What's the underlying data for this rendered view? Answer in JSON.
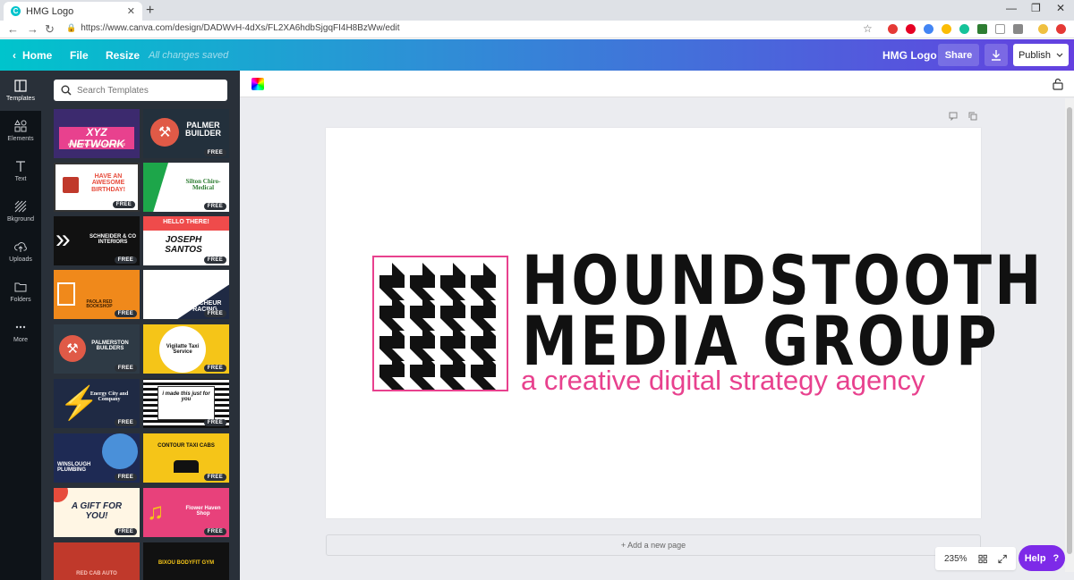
{
  "browser": {
    "tab_title": "HMG Logo",
    "new_tab": "+",
    "url": "https://www.canva.com/design/DADWvH-4dXs/FL2XA6hdbSjgqFI4H8BzWw/edit"
  },
  "header": {
    "home": "Home",
    "file": "File",
    "resize": "Resize",
    "status": "All changes saved",
    "doc_title": "HMG Logo",
    "share": "Share",
    "publish": "Publish"
  },
  "rail": {
    "templates": "Templates",
    "elements": "Elements",
    "text": "Text",
    "background": "Bkground",
    "uploads": "Uploads",
    "folders": "Folders",
    "more": "More"
  },
  "panel": {
    "search_placeholder": "Search Templates",
    "free_label": "FREE",
    "templates": [
      {
        "title": "XYZ NETWORK",
        "sub": "PRESENTED BY CIA RODRIGUEZ"
      },
      {
        "title": "PALMER BUILDER",
        "sub": ""
      },
      {
        "title": "HAVE AN AWESOME BIRTHDAY!",
        "sub": ""
      },
      {
        "title": "Silton Chiro-Medical",
        "sub": ""
      },
      {
        "title": "SCHNEIDER & CO INTERIORS",
        "sub": ""
      },
      {
        "title": "HELLO THERE!",
        "sub": "JOSEPH SANTOS"
      },
      {
        "title": "PAOLA RED BOOKSHOP",
        "sub": ""
      },
      {
        "title": "MILCHEUR RACING",
        "sub": ""
      },
      {
        "title": "PALMERSTON BUILDERS",
        "sub": ""
      },
      {
        "title": "Vigilatte Taxi Service",
        "sub": ""
      },
      {
        "title": "Energy City and Company",
        "sub": ""
      },
      {
        "title": "i made this just for you",
        "sub": ""
      },
      {
        "title": "WINSLOUGH PLUMBING",
        "sub": ""
      },
      {
        "title": "CONTOUR TAXI CABS",
        "sub": ""
      },
      {
        "title": "A GIFT FOR YOU!",
        "sub": ""
      },
      {
        "title": "Flower Haven Shop",
        "sub": ""
      },
      {
        "title": "RED CAB AUTO",
        "sub": ""
      },
      {
        "title": "BIXOU BODYFIT GYM",
        "sub": ""
      }
    ]
  },
  "canvas": {
    "logo_line1": "HOUNDSTOOTH",
    "logo_line2": "MEDIA GROUP",
    "tagline": "a creative digital strategy agency",
    "add_page": "+ Add a new page"
  },
  "footer": {
    "zoom": "235%",
    "help": "Help",
    "help_icon": "?"
  },
  "colors": {
    "accent": "#7d2ae8",
    "logo_pink": "#e8418e",
    "logo_black": "#111111"
  }
}
